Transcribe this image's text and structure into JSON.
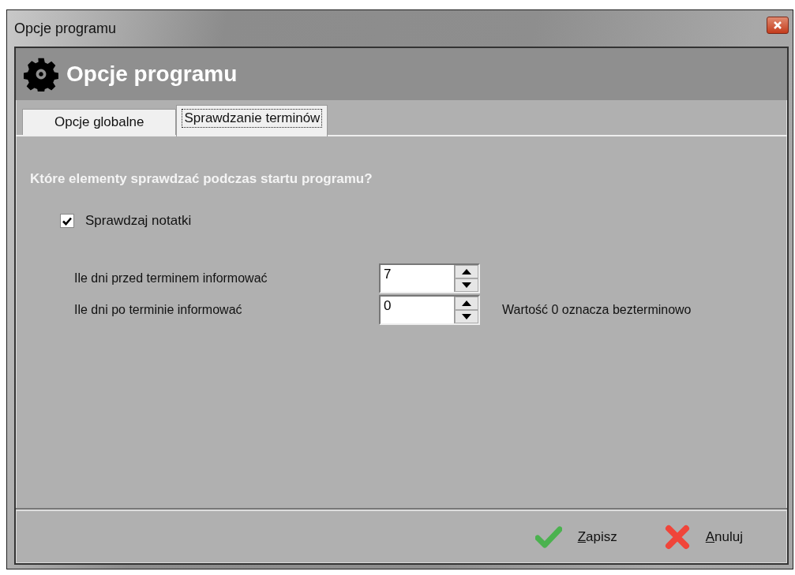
{
  "window": {
    "title": "Opcje programu"
  },
  "header": {
    "title": "Opcje programu"
  },
  "tabs": [
    {
      "label": "Opcje globalne",
      "selected": false
    },
    {
      "label": "Sprawdzanie terminów",
      "selected": true
    }
  ],
  "question": "Które elementy sprawdzać podczas startu programu?",
  "checkbox": {
    "label": "Sprawdzaj notatki",
    "checked": true
  },
  "spinners": [
    {
      "label": "Ile dni przed terminem informować",
      "value": "7"
    },
    {
      "label": "Ile dni po terminie informować",
      "value": "0",
      "hint": "Wartość 0 oznacza bezterminowo"
    }
  ],
  "buttons": [
    {
      "kind": "ok",
      "label": "Zapisz"
    },
    {
      "kind": "cancel",
      "label": "Anuluj"
    }
  ]
}
